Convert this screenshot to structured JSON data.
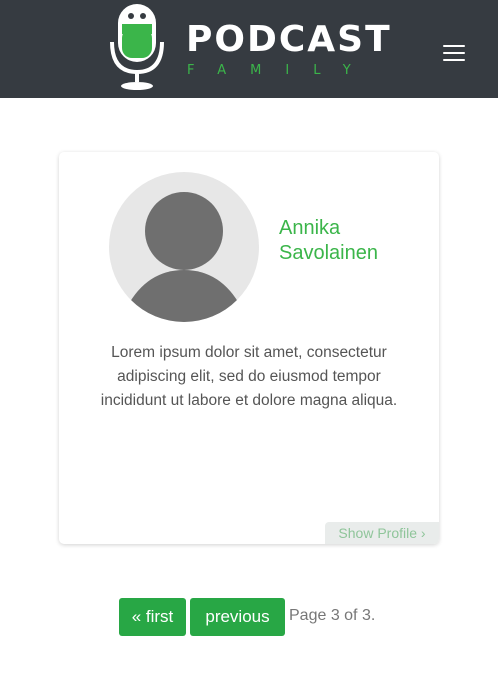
{
  "header": {
    "logo_title": "PODCAST",
    "logo_subtitle": "FAMILY",
    "menu_icon": "hamburger-menu-icon",
    "background": "#363b41",
    "accent": "#3bb54a"
  },
  "member_card": {
    "avatar_icon": "user-placeholder-icon",
    "name": "Annika Savolainen",
    "bio": "Lorem ipsum dolor sit amet, consectetur adipiscing elit, sed do eiusmod tempor incididunt ut labore et dolore magna aliqua.",
    "show_profile_label": "Show Profile ›"
  },
  "pagination": {
    "first_label": "« first",
    "previous_label": "previous",
    "page_info": "Page 3 of 3.",
    "button_color": "#28a745"
  }
}
